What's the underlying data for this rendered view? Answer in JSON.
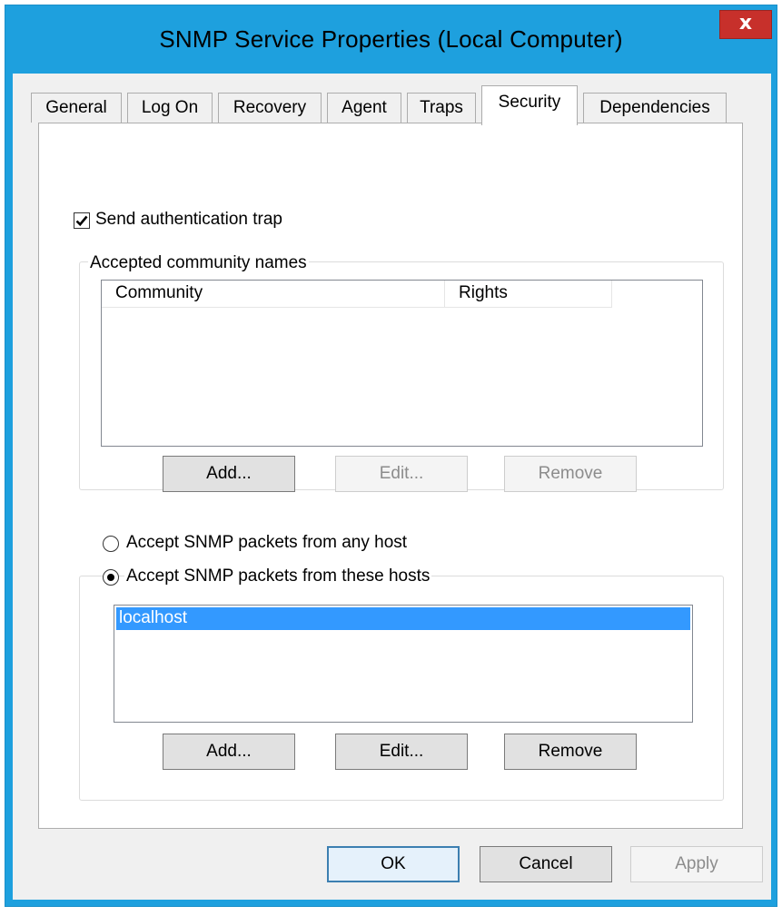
{
  "window": {
    "title": "SNMP Service Properties (Local Computer)",
    "close_label": "x"
  },
  "tabs": [
    {
      "label": "General"
    },
    {
      "label": "Log On"
    },
    {
      "label": "Recovery"
    },
    {
      "label": "Agent"
    },
    {
      "label": "Traps"
    },
    {
      "label": "Security",
      "active": true
    },
    {
      "label": "Dependencies"
    }
  ],
  "security": {
    "send_auth_trap": {
      "label": "Send authentication trap",
      "checked": true
    },
    "community_group": {
      "legend": "Accepted community names",
      "columns": [
        "Community",
        "Rights"
      ],
      "rows": [],
      "buttons": {
        "add": "Add...",
        "edit": "Edit...",
        "remove": "Remove"
      }
    },
    "accept_any_host": {
      "label": "Accept SNMP packets from any host",
      "selected": false
    },
    "accept_these_hosts": {
      "label": "Accept SNMP packets from these hosts",
      "selected": true
    },
    "hosts_group": {
      "hosts": [
        "localhost"
      ],
      "selected_index": 0,
      "buttons": {
        "add": "Add...",
        "edit": "Edit...",
        "remove": "Remove"
      }
    }
  },
  "footer": {
    "ok": "OK",
    "cancel": "Cancel",
    "apply": "Apply"
  },
  "colors": {
    "title_bar": "#1ea0de",
    "close_button": "#c7302b",
    "selection": "#3399ff"
  }
}
